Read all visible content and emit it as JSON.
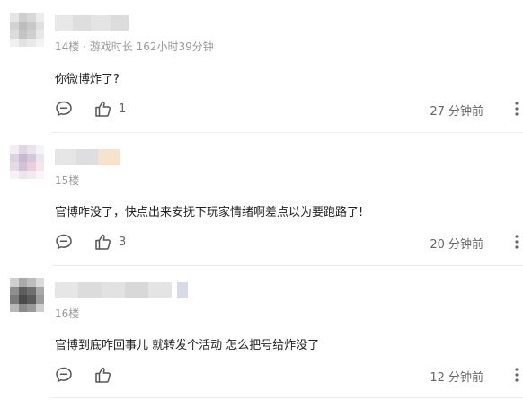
{
  "comments": [
    {
      "floor": "14楼",
      "separator": " · ",
      "playtime_label": "游戏时长",
      "playtime_value": "162小时39分钟",
      "text": "你微博炸了?",
      "likes": "1",
      "time": "27 分钟前",
      "icons": {
        "reply": "comment-bubble-icon",
        "like": "thumbs-up-icon",
        "more": "more-options-icon"
      }
    },
    {
      "floor": "15楼",
      "text": "官博咋没了，快点出来安抚下玩家情绪啊差点以为要跑路了!",
      "likes": "3",
      "time": "20 分钟前",
      "icons": {
        "reply": "comment-bubble-icon",
        "like": "thumbs-up-icon",
        "more": "more-options-icon"
      }
    },
    {
      "floor": "16楼",
      "text": "官博到底咋回事儿 就转发个活动 怎么把号给炸没了",
      "likes": "",
      "time": "12 分钟前",
      "icons": {
        "reply": "comment-bubble-icon",
        "like": "thumbs-up-icon",
        "more": "more-options-icon"
      }
    }
  ],
  "colors": {
    "meta_text": "#9a9a9a",
    "body_text": "#222222",
    "action_text": "#666666",
    "divider": "#ededed"
  }
}
